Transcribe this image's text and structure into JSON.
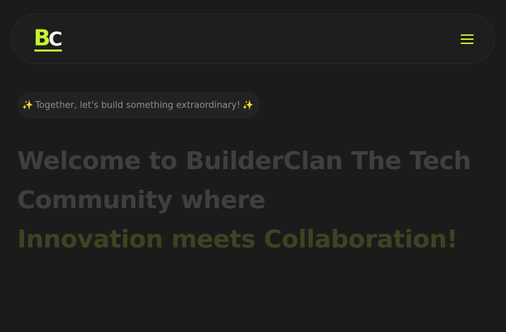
{
  "navbar": {
    "logo": {
      "letter_primary": "B",
      "letter_secondary": "C"
    },
    "menu_icon": "hamburger-menu-icon"
  },
  "hero": {
    "tagline": {
      "emoji": "✨",
      "text": "Together, let's build something extraordinary!"
    },
    "headline": {
      "main": "Welcome to BuilderClan The Tech Community where",
      "accent": "Innovation meets Collaboration!"
    }
  },
  "colors": {
    "background": "#1b1b1b",
    "accent": "#c6f432",
    "headline_main": "#3f3f3f",
    "headline_accent": "#3a4423"
  }
}
